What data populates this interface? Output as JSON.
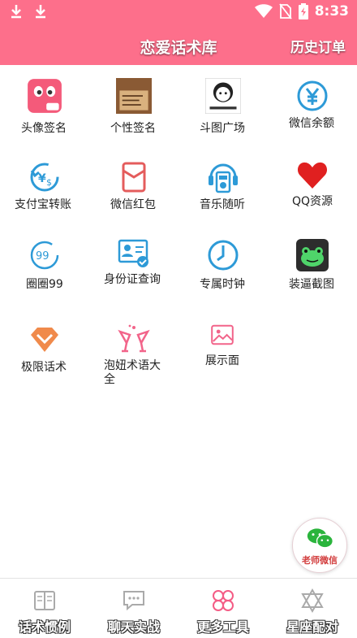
{
  "status_bar": {
    "time": "8:33",
    "icons": [
      "download-icon",
      "download-icon",
      "wifi-icon",
      "no-sim-icon",
      "battery-icon"
    ]
  },
  "header": {
    "title": "恋爱话术库",
    "right_action": "历史订单"
  },
  "colors": {
    "brand": "#fd6f8b",
    "accent_blue": "#2d9ad7",
    "tab_active": "#f45c85"
  },
  "grid": [
    {
      "label": "头像签名",
      "icon": "avatar-sign-icon"
    },
    {
      "label": "个性签名",
      "icon": "signature-icon"
    },
    {
      "label": "斗图广场",
      "icon": "meme-icon"
    },
    {
      "label": "微信余额",
      "icon": "yen-icon"
    },
    {
      "label": "支付宝转账",
      "icon": "alipay-transfer-icon"
    },
    {
      "label": "微信红包",
      "icon": "red-packet-icon"
    },
    {
      "label": "音乐随听",
      "icon": "music-player-icon"
    },
    {
      "label": "QQ资源",
      "icon": "heart-icon"
    },
    {
      "label": "圈圈99",
      "icon": "circle-99-icon"
    },
    {
      "label": "身份证查询",
      "icon": "id-card-icon"
    },
    {
      "label": "专属时钟",
      "icon": "clock-icon"
    },
    {
      "label": "装逼截图",
      "icon": "frog-icon"
    },
    {
      "label": "极限话术",
      "icon": "diamond-icon"
    },
    {
      "label": "泡妞术语大全",
      "icon": "cheers-icon"
    },
    {
      "label": "展示面",
      "icon": "picture-icon"
    }
  ],
  "floating_button": {
    "label": "老师微信",
    "icon": "wechat-icon"
  },
  "tabs": [
    {
      "label": "话术惯例",
      "icon": "book-icon",
      "active": false
    },
    {
      "label": "聊天实战",
      "icon": "chat-icon",
      "active": false
    },
    {
      "label": "更多工具",
      "icon": "grid-icon",
      "active": true
    },
    {
      "label": "星座配对",
      "icon": "star-icon",
      "active": false
    }
  ]
}
